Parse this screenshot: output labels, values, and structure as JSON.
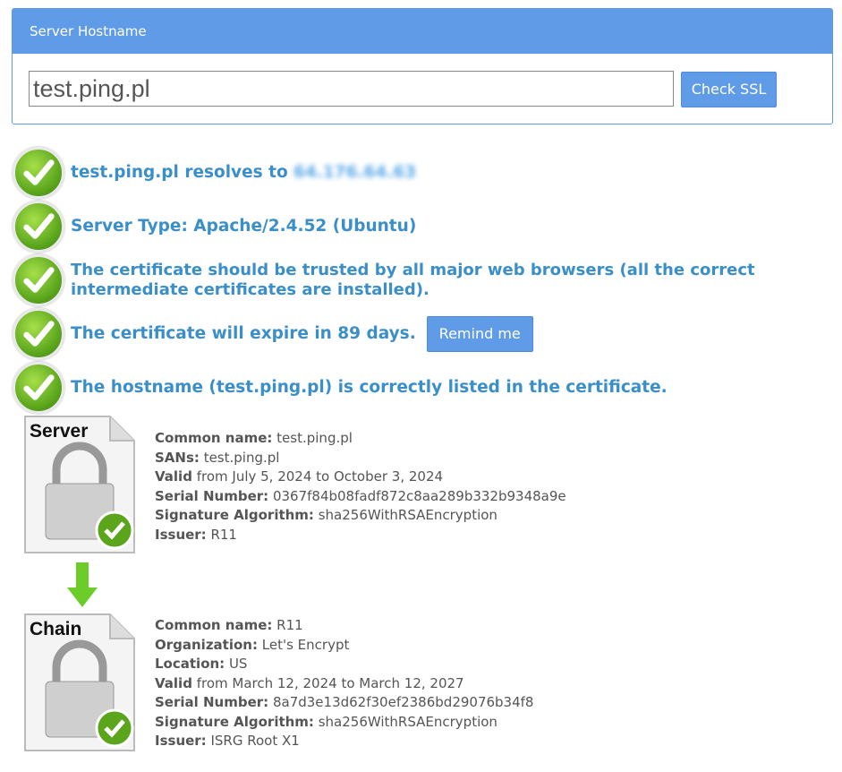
{
  "form": {
    "header": "Server Hostname",
    "hostname_value": "test.ping.pl",
    "check_button": "Check SSL"
  },
  "results": [
    {
      "prefix": "test.ping.pl resolves to",
      "ip": "64.176.64.63"
    },
    {
      "text": "Server Type: Apache/2.4.52 (Ubuntu)"
    },
    {
      "text": "The certificate should be trusted by all major web browsers (all the correct intermediate certificates are installed)."
    },
    {
      "text": "The certificate will expire in 89 days.",
      "button": "Remind me"
    },
    {
      "text": "The hostname (test.ping.pl) is correctly listed in the certificate."
    }
  ],
  "server_cert": {
    "label": "Server",
    "fields": [
      {
        "k": "Common name:",
        "v": "test.ping.pl"
      },
      {
        "k": "SANs:",
        "v": "test.ping.pl"
      },
      {
        "k": "Valid",
        "v": "from July 5, 2024 to October 3, 2024"
      },
      {
        "k": "Serial Number:",
        "v": "0367f84b08fadf872c8aa289b332b9348a9e"
      },
      {
        "k": "Signature Algorithm:",
        "v": "sha256WithRSAEncryption"
      },
      {
        "k": "Issuer:",
        "v": "R11"
      }
    ]
  },
  "chain_cert": {
    "label": "Chain",
    "fields": [
      {
        "k": "Common name:",
        "v": "R11"
      },
      {
        "k": "Organization:",
        "v": "Let's Encrypt"
      },
      {
        "k": "Location:",
        "v": "US"
      },
      {
        "k": "Valid",
        "v": "from March 12, 2024 to March 12, 2027"
      },
      {
        "k": "Serial Number:",
        "v": "8a7d3e13d62f30ef2386bd29076b34f8"
      },
      {
        "k": "Signature Algorithm:",
        "v": "sha256WithRSAEncryption"
      },
      {
        "k": "Issuer:",
        "v": "ISRG Root X1"
      }
    ]
  },
  "colors": {
    "accent": "#5f9be6",
    "message": "#3b8fc8",
    "check_green": "#5aa51c"
  }
}
